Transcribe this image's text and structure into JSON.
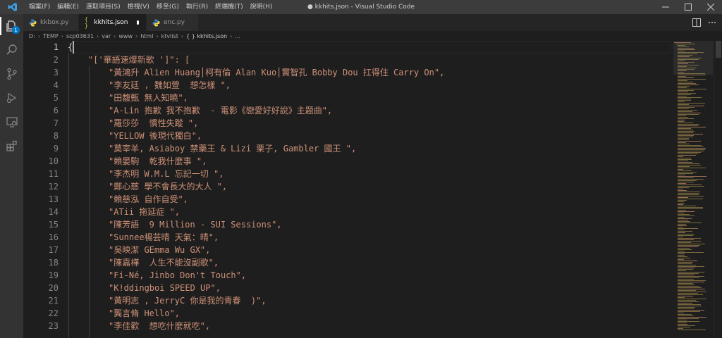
{
  "titlebar": {
    "menu": [
      "檔案(F)",
      "編輯(E)",
      "選取項目(S)",
      "檢視(V)",
      "移至(G)",
      "執行(R)",
      "終端機(T)",
      "說明(H)"
    ],
    "window_title": "● kkhits.json - Visual Studio Code"
  },
  "activity": {
    "explorer_badge": "1"
  },
  "tabs": [
    {
      "label": "kkbox.py",
      "icon": "python-icon",
      "active": false
    },
    {
      "label": "kkhits.json",
      "icon": "json-braces-icon",
      "active": true,
      "dirty": true
    },
    {
      "label": "enc.py",
      "icon": "python-icon",
      "active": false
    }
  ],
  "breadcrumb": [
    "D:",
    "TEMP",
    "scp03631",
    "var",
    "www",
    "html",
    "ktvlist",
    "{ } kkhits.json",
    "..."
  ],
  "editor": {
    "lines": [
      {
        "n": "1",
        "text": "{"
      },
      {
        "n": "2",
        "text": "\"['華語速爆新歌 ']\": ["
      },
      {
        "n": "3",
        "text": "\"黃鴻升 Alien Huang│柯有倫 Alan Kuo│竇智孔 Bobby Dou 扛得住 Carry On\","
      },
      {
        "n": "4",
        "text": "\"李友廷 , 魏如萱  想怎樣 \","
      },
      {
        "n": "5",
        "text": "\"田馥甄 無人知曉\","
      },
      {
        "n": "6",
        "text": "\"A-Lin 抱歉 我不抱歉  - 電影《戀愛好好說》主題曲\","
      },
      {
        "n": "7",
        "text": "\"羅莎莎  慣性失蹤 \","
      },
      {
        "n": "8",
        "text": "\"YELLOW 後現代獨白\","
      },
      {
        "n": "9",
        "text": "\"莫宰羊, Asiaboy 禁藥王 & Lizi 栗子, Gambler 國王 \","
      },
      {
        "n": "10",
        "text": "\"賴晏駒  乾我什麼事 \","
      },
      {
        "n": "11",
        "text": "\"李杰明 W.M.L 忘記一切 \","
      },
      {
        "n": "12",
        "text": "\"鄭心慈 學不會長大的大人 \","
      },
      {
        "n": "13",
        "text": "\"賴慈泓 自作自受\","
      },
      {
        "n": "14",
        "text": "\"ATii 拖延症 \","
      },
      {
        "n": "15",
        "text": "\"陳芳語  9 Million - SUI Sessions\","
      },
      {
        "n": "16",
        "text": "\"Sunnee楊芸晴 天氣：晴\","
      },
      {
        "n": "17",
        "text": "\"吳映潔 GEmma Wu GX\","
      },
      {
        "n": "18",
        "text": "\"陳嘉樺  人生不能沒副歌\","
      },
      {
        "n": "19",
        "text": "\"Fi-Né, Jinbo Don't Touch\","
      },
      {
        "n": "20",
        "text": "\"K!ddingboi SPEED UP\","
      },
      {
        "n": "21",
        "text": "\"黃明志 , JerryC 你是我的青春  )\","
      },
      {
        "n": "22",
        "text": "\"龔言脩 Hello\","
      },
      {
        "n": "23",
        "text": "\"李佳歡  想吃什麼就吃\","
      }
    ]
  },
  "colors": {
    "string": "#ce9178",
    "accent": "#007acc"
  }
}
